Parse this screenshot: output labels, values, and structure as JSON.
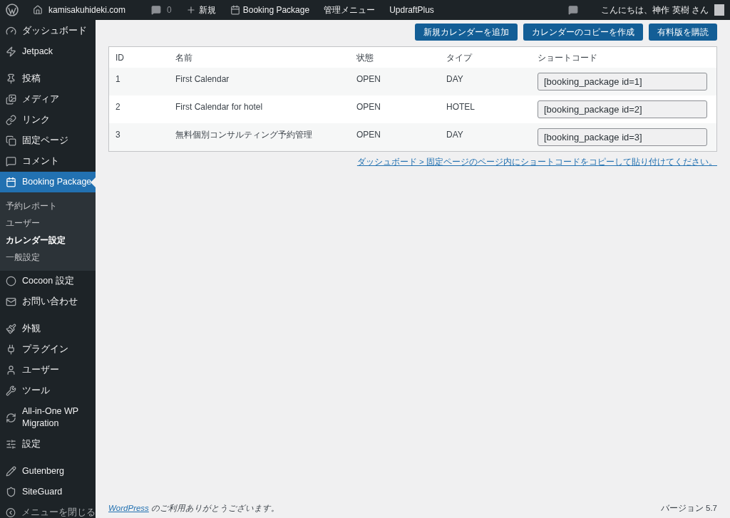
{
  "admin_bar": {
    "site": "kamisakuhideki.com",
    "comments": "0",
    "new": "新規",
    "plugin": "Booking Package",
    "menu": "管理メニュー",
    "backup": "UpdraftPlus",
    "greeting": "こんにちは、神作 英樹 さん"
  },
  "sidebar": {
    "sections": [
      [
        {
          "label": "ダッシュボード",
          "selected": false
        },
        {
          "label": "Jetpack",
          "selected": false
        }
      ],
      [
        {
          "label": "投稿",
          "selected": false
        },
        {
          "label": "メディア",
          "selected": false
        },
        {
          "label": "リンク",
          "selected": false
        },
        {
          "label": "固定ページ",
          "selected": false
        },
        {
          "label": "コメント",
          "selected": false
        },
        {
          "label": "Booking Package",
          "selected": true,
          "children": [
            {
              "label": "予約レポート",
              "selected": false
            },
            {
              "label": "ユーザー",
              "selected": false
            },
            {
              "label": "カレンダー設定",
              "selected": true
            },
            {
              "label": "一般設定",
              "selected": false
            }
          ]
        },
        {
          "label": "Cocoon 設定",
          "selected": false
        },
        {
          "label": "お問い合わせ",
          "selected": false
        }
      ],
      [
        {
          "label": "外観",
          "selected": false
        },
        {
          "label": "プラグイン",
          "selected": false
        },
        {
          "label": "ユーザー",
          "selected": false
        },
        {
          "label": "ツール",
          "selected": false
        },
        {
          "label": "All-in-One WP Migration",
          "selected": false
        },
        {
          "label": "設定",
          "selected": false
        }
      ],
      [
        {
          "label": "Gutenberg",
          "selected": false
        },
        {
          "label": "SiteGuard",
          "selected": false
        }
      ]
    ],
    "collapse": "メニューを閉じる"
  },
  "buttons": [
    "新規カレンダーを追加",
    "カレンダーのコピーを作成",
    "有料版を購読"
  ],
  "table": {
    "columns": [
      "ID",
      "名前",
      "状態",
      "タイプ",
      "ショートコード"
    ],
    "rows": [
      {
        "id": "1",
        "name": "First Calendar",
        "status": "OPEN",
        "type": "DAY",
        "shortcode": "[booking_package id=1]"
      },
      {
        "id": "2",
        "name": "First Calendar for hotel",
        "status": "OPEN",
        "type": "HOTEL",
        "shortcode": "[booking_package id=2]"
      },
      {
        "id": "3",
        "name": "無料個別コンサルティング予約管理",
        "status": "OPEN",
        "type": "DAY",
        "shortcode": "[booking_package id=3]"
      }
    ]
  },
  "hint_link": "ダッシュボード > 固定ページのページ内にショートコードをコピーして貼り付けてください。",
  "footer": {
    "link": "WordPress",
    "text": " のご利用ありがとうございます。",
    "version": "バージョン 5.7"
  }
}
